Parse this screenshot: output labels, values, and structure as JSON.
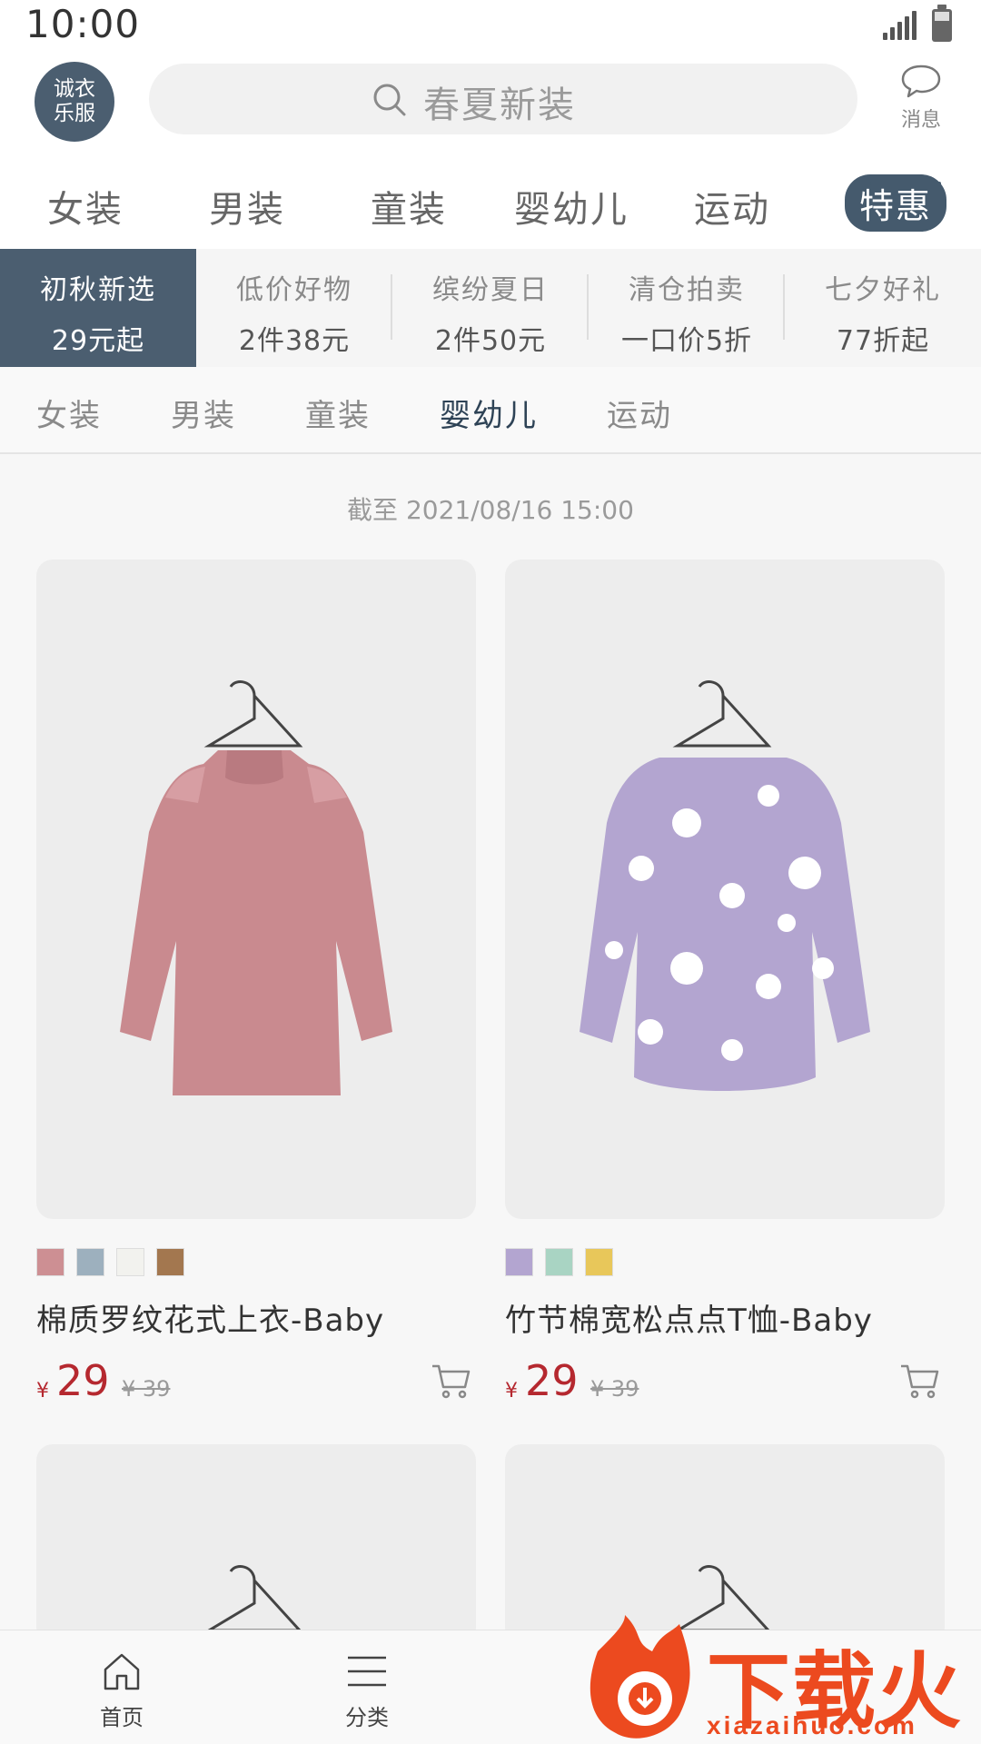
{
  "status": {
    "time": "10:00"
  },
  "header": {
    "logo_line1": "诚衣",
    "logo_line2": "乐服",
    "search_placeholder": "春夏新装",
    "message_label": "消息"
  },
  "tabs": [
    "女装",
    "男装",
    "童装",
    "婴幼儿",
    "运动",
    "特惠"
  ],
  "active_tab": "特惠",
  "promos": [
    {
      "title": "初秋新选",
      "subtitle": "29元起",
      "active": true
    },
    {
      "title": "低价好物",
      "subtitle": "2件38元",
      "active": false
    },
    {
      "title": "缤纷夏日",
      "subtitle": "2件50元",
      "active": false
    },
    {
      "title": "清仓拍卖",
      "subtitle": "一口价5折",
      "active": false
    },
    {
      "title": "七夕好礼",
      "subtitle": "77折起",
      "active": false
    }
  ],
  "subtabs": [
    "女装",
    "男装",
    "童装",
    "婴幼儿",
    "运动"
  ],
  "active_subtab": "婴幼儿",
  "deadline": "截至 2021/08/16 15:00",
  "products": [
    {
      "name": "棉质罗纹花式上衣-Baby",
      "currency": "¥",
      "price": "29",
      "old_price": "¥ 39",
      "swatches": [
        "#cd8f93",
        "#9db0be",
        "#f2f2ee",
        "#a3774f"
      ]
    },
    {
      "name": "竹节棉宽松点点T恤-Baby",
      "currency": "¥",
      "price": "29",
      "old_price": "¥ 39",
      "swatches": [
        "#b3a5d0",
        "#a9d4c3",
        "#e8c75a"
      ]
    }
  ],
  "bottom_nav": [
    {
      "label": "首页",
      "icon": "home-icon"
    },
    {
      "label": "分类",
      "icon": "menu-icon"
    }
  ],
  "watermark": {
    "text": "下载火",
    "url": "xiazaihuo.com"
  },
  "colors": {
    "accent": "#455a6d",
    "price": "#b5282f",
    "watermark": "#ec4a1f"
  }
}
